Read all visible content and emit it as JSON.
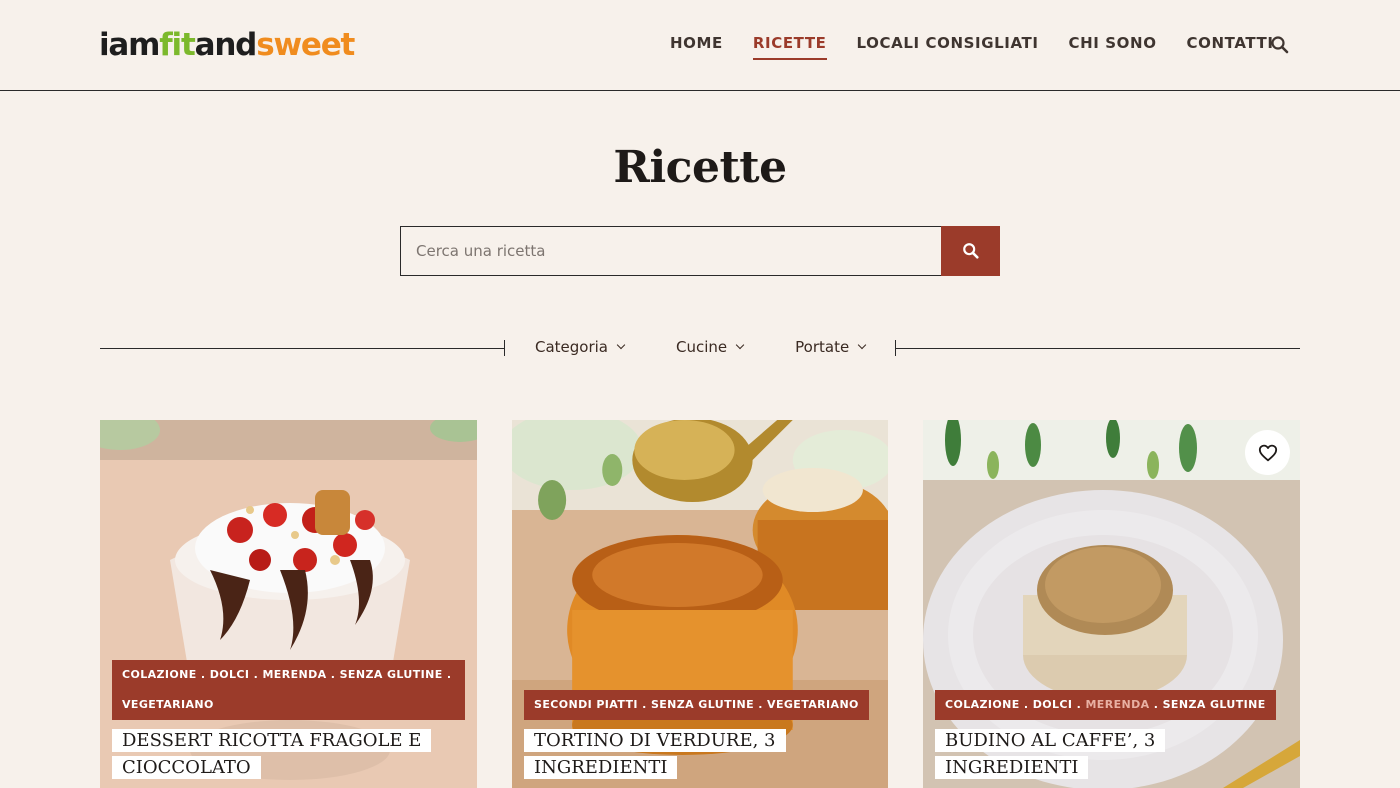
{
  "brand": {
    "logo_parts": [
      "iam",
      "fit",
      "and",
      "sweet"
    ]
  },
  "nav": {
    "items": [
      "HOME",
      "RICETTE",
      "LOCALI CONSIGLIATI",
      "CHI SONO",
      "CONTATTI"
    ],
    "active": "RICETTE",
    "search_icon": "search-icon"
  },
  "page": {
    "title": "Ricette"
  },
  "search": {
    "placeholder": "Cerca una ricetta",
    "button_icon": "search-icon"
  },
  "filters": {
    "items": [
      "Categoria",
      "Cucine",
      "Portate"
    ],
    "icon": "chevron-down-icon"
  },
  "recipes": [
    {
      "tags": [
        "COLAZIONE",
        "DOLCI",
        "MERENDA",
        "SENZA GLUTINE",
        "VEGETARIANO"
      ],
      "title": "DESSERT RICOTTA FRAGOLE E CIOCCOLATO",
      "image": "strawberry-ricotta-chocolate-dessert"
    },
    {
      "tags": [
        "SECONDI PIATTI",
        "SENZA GLUTINE",
        "VEGETARIANO"
      ],
      "title": "TORTINO DI VERDURE, 3 INGREDIENTI",
      "image": "vegetable-muffin-tortino"
    },
    {
      "tags": [
        "COLAZIONE",
        "DOLCI",
        "MERENDA",
        "SENZA GLUTINE"
      ],
      "title": "BUDINO AL CAFFE’, 3 INGREDIENTI",
      "image": "coffee-pudding-plate",
      "favorite_icon": "heart-icon"
    }
  ],
  "colors": {
    "accent": "#9b3b2a",
    "background": "#f7f1eb",
    "logo_green": "#7cb92c",
    "logo_orange": "#f08c1e"
  }
}
